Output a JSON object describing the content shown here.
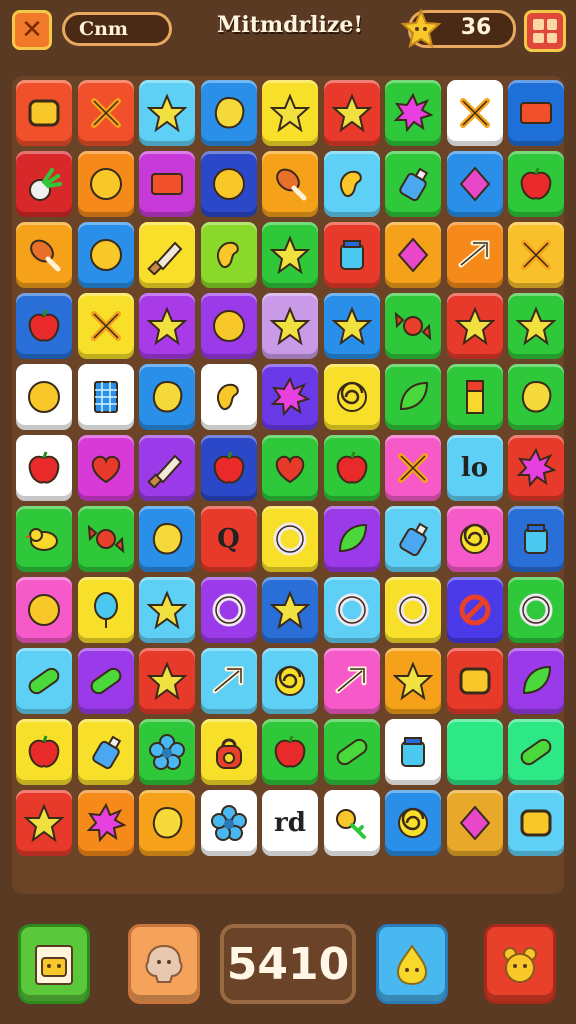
{
  "header": {
    "name_label": "Cnm",
    "title": "Mitmdrlize!",
    "stars_count": "36"
  },
  "footer": {
    "score": "5410"
  },
  "board": {
    "rows": [
      [
        {
          "color": "#f0502a",
          "icon": "square"
        },
        {
          "color": "#f0502a",
          "icon": "x"
        },
        {
          "color": "#5fd0f5",
          "icon": "star"
        },
        {
          "color": "#2a8fe8",
          "icon": "blob"
        },
        {
          "color": "#f8e02a",
          "icon": "star"
        },
        {
          "color": "#e83a2a",
          "icon": "star"
        },
        {
          "color": "#2ec83a",
          "icon": "splat"
        },
        {
          "color": "#ffffff",
          "icon": "x"
        },
        {
          "color": "#1f6fd8",
          "icon": "rect"
        }
      ],
      [
        {
          "color": "#d8282a",
          "icon": "radish"
        },
        {
          "color": "#f58a1a",
          "icon": "circle"
        },
        {
          "color": "#c83ad8",
          "icon": "rect"
        },
        {
          "color": "#2a48c8",
          "icon": "circle"
        },
        {
          "color": "#f5a21a",
          "icon": "drumstick"
        },
        {
          "color": "#5fd0f5",
          "icon": "bean"
        },
        {
          "color": "#2ec83a",
          "icon": "bottle"
        },
        {
          "color": "#2a8fe8",
          "icon": "diamond"
        },
        {
          "color": "#2ec83a",
          "icon": "apple"
        }
      ],
      [
        {
          "color": "#f5a21a",
          "icon": "drumstick"
        },
        {
          "color": "#2a8fe8",
          "icon": "circle"
        },
        {
          "color": "#f8e02a",
          "icon": "knife"
        },
        {
          "color": "#8ad82a",
          "icon": "bean"
        },
        {
          "color": "#2ec83a",
          "icon": "star"
        },
        {
          "color": "#e83a2a",
          "icon": "jar"
        },
        {
          "color": "#f5a21a",
          "icon": "diamond"
        },
        {
          "color": "#f58a1a",
          "icon": "arrow"
        },
        {
          "color": "#f8c02a",
          "icon": "x"
        }
      ],
      [
        {
          "color": "#2a6fd8",
          "icon": "apple"
        },
        {
          "color": "#f8e02a",
          "icon": "x"
        },
        {
          "color": "#a83ae8",
          "icon": "star"
        },
        {
          "color": "#9a3ae8",
          "icon": "circle"
        },
        {
          "color": "#c89ae8",
          "icon": "star"
        },
        {
          "color": "#2a8fe8",
          "icon": "star"
        },
        {
          "color": "#2ec83a",
          "icon": "candy"
        },
        {
          "color": "#e83a2a",
          "icon": "star"
        },
        {
          "color": "#2ec83a",
          "icon": "star"
        }
      ],
      [
        {
          "color": "#ffffff",
          "icon": "circle"
        },
        {
          "color": "#ffffff",
          "icon": "grid"
        },
        {
          "color": "#2a8fe8",
          "icon": "blob"
        },
        {
          "color": "#ffffff",
          "icon": "bean"
        },
        {
          "color": "#6a3ae8",
          "icon": "splat"
        },
        {
          "color": "#f8e02a",
          "icon": "swirl"
        },
        {
          "color": "#2ec83a",
          "icon": "leaf"
        },
        {
          "color": "#2ec83a",
          "icon": "bar"
        },
        {
          "color": "#2ec83a",
          "icon": "blob"
        }
      ],
      [
        {
          "color": "#ffffff",
          "icon": "apple"
        },
        {
          "color": "#d83ad8",
          "icon": "heart"
        },
        {
          "color": "#9a3ae8",
          "icon": "knife"
        },
        {
          "color": "#2a48c8",
          "icon": "apple"
        },
        {
          "color": "#2ec83a",
          "icon": "heart"
        },
        {
          "color": "#2ec83a",
          "icon": "apple"
        },
        {
          "color": "#f55ac8",
          "icon": "x"
        },
        {
          "color": "#5fd0f5",
          "icon": "text",
          "text": "lo"
        },
        {
          "color": "#e83a2a",
          "icon": "splat"
        }
      ],
      [
        {
          "color": "#2ec83a",
          "icon": "bird"
        },
        {
          "color": "#2ec83a",
          "icon": "candy"
        },
        {
          "color": "#2a8fe8",
          "icon": "blob"
        },
        {
          "color": "#e83a2a",
          "icon": "text",
          "text": "Q"
        },
        {
          "color": "#f8e02a",
          "icon": "ring"
        },
        {
          "color": "#9a3ae8",
          "icon": "leaf"
        },
        {
          "color": "#5fd0f5",
          "icon": "bottle"
        },
        {
          "color": "#f55ac8",
          "icon": "swirl"
        },
        {
          "color": "#2a6fd8",
          "icon": "jar"
        }
      ],
      [
        {
          "color": "#f55ac8",
          "icon": "circle"
        },
        {
          "color": "#f8e02a",
          "icon": "balloon"
        },
        {
          "color": "#5fd0f5",
          "icon": "star"
        },
        {
          "color": "#9a3ae8",
          "icon": "ring"
        },
        {
          "color": "#2a6fd8",
          "icon": "star"
        },
        {
          "color": "#5fd0f5",
          "icon": "ring"
        },
        {
          "color": "#f8e02a",
          "icon": "ring"
        },
        {
          "color": "#4a3ae8",
          "icon": "ban"
        },
        {
          "color": "#2ec83a",
          "icon": "ring"
        }
      ],
      [
        {
          "color": "#5fd0f5",
          "icon": "pill"
        },
        {
          "color": "#9a3ae8",
          "icon": "pill"
        },
        {
          "color": "#e83a2a",
          "icon": "star"
        },
        {
          "color": "#5fd0f5",
          "icon": "arrow"
        },
        {
          "color": "#5fd0f5",
          "icon": "swirl"
        },
        {
          "color": "#f55ac8",
          "icon": "arrow"
        },
        {
          "color": "#f5a21a",
          "icon": "star"
        },
        {
          "color": "#e83a2a",
          "icon": "square"
        },
        {
          "color": "#9a3ae8",
          "icon": "leaf"
        }
      ],
      [
        {
          "color": "#f8e02a",
          "icon": "apple"
        },
        {
          "color": "#f8e02a",
          "icon": "bottle"
        },
        {
          "color": "#2ec83a",
          "icon": "flower"
        },
        {
          "color": "#f8e02a",
          "icon": "weight"
        },
        {
          "color": "#2ec83a",
          "icon": "apple"
        },
        {
          "color": "#2ec83a",
          "icon": "pill"
        },
        {
          "color": "#ffffff",
          "icon": "jar"
        },
        {
          "color": "#2ee888",
          "icon": "none"
        },
        {
          "color": "#2ee888",
          "icon": "pill"
        }
      ],
      [
        {
          "color": "#e83a2a",
          "icon": "star"
        },
        {
          "color": "#f58a1a",
          "icon": "splat"
        },
        {
          "color": "#f5a21a",
          "icon": "blob"
        },
        {
          "color": "#ffffff",
          "icon": "flower"
        },
        {
          "color": "#ffffff",
          "icon": "text",
          "text": "rd"
        },
        {
          "color": "#ffffff",
          "icon": "key"
        },
        {
          "color": "#2a8fe8",
          "icon": "swirl"
        },
        {
          "color": "#e8a82a",
          "icon": "diamond"
        },
        {
          "color": "#5fd0f5",
          "icon": "square"
        }
      ]
    ]
  }
}
